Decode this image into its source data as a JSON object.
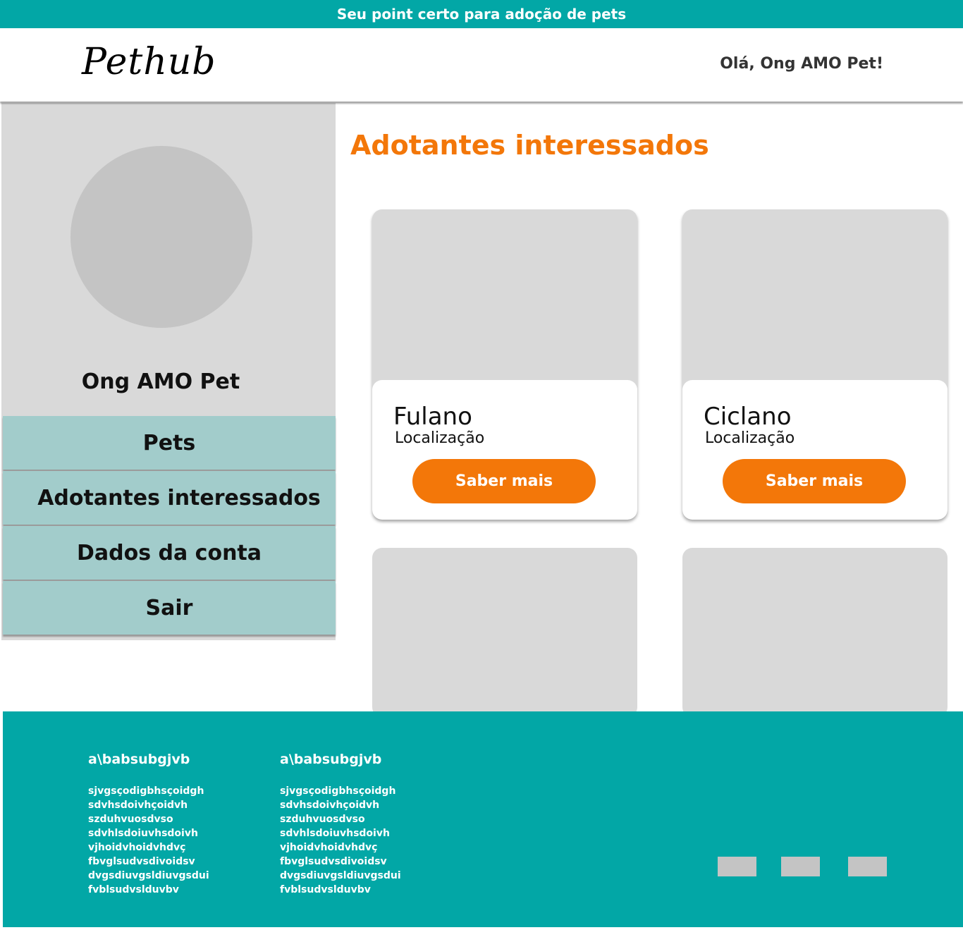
{
  "topbar": {
    "tagline": "Seu point certo para adoção de pets"
  },
  "header": {
    "logo": "Pethub",
    "greeting": "Olá, Ong AMO Pet!"
  },
  "sidebar": {
    "org_name": "Ong AMO Pet",
    "menu": [
      {
        "label": "Pets"
      },
      {
        "label": "Adotantes interessados"
      },
      {
        "label": "Dados da conta"
      },
      {
        "label": "Sair"
      }
    ]
  },
  "main": {
    "title": "Adotantes interessados",
    "cards": [
      {
        "name": "Fulano",
        "location": "Localização",
        "button": "Saber mais"
      },
      {
        "name": "Ciclano",
        "location": "Localização",
        "button": "Saber mais"
      }
    ]
  },
  "footer": {
    "columns": [
      {
        "title": "a\\babsubgjvb",
        "lines": [
          "sjvgsçodigbhsçoidgh",
          "sdvhsdoivhçoidvh",
          "szduhvuosdvso",
          "sdvhlsdoiuvhsdoivh",
          "vjhoidvhoidvhdvç",
          "fbvglsudvsdivoidsv",
          "dvgsdiuvgsldiuvgsdui",
          "fvblsudvslduvbv"
        ]
      },
      {
        "title": "a\\babsubgjvb",
        "lines": [
          "sjvgsçodigbhsçoidgh",
          "sdvhsdoivhçoidvh",
          "szduhvuosdvso",
          "sdvhlsdoiuvhsdoivh",
          "vjhoidvhoidvhdvç",
          "fbvglsudvsdivoidsv",
          "dvgsdiuvgsldiuvgsdui",
          "fvblsudvslduvbv"
        ]
      }
    ]
  },
  "colors": {
    "teal": "#02a7a6",
    "orange": "#f37709",
    "menu": "#a2cccb",
    "placeholder": "#d9d9d9"
  }
}
